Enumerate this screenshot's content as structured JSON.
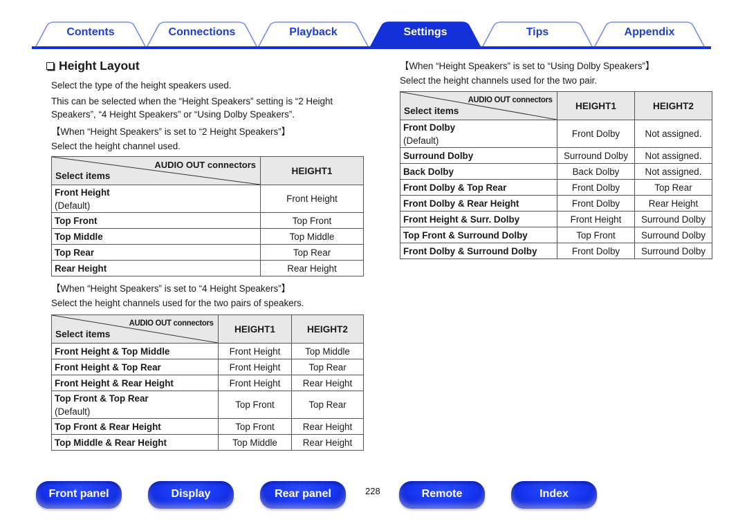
{
  "tabs": [
    {
      "label": "Contents",
      "active": false
    },
    {
      "label": "Connections",
      "active": false
    },
    {
      "label": "Playback",
      "active": false
    },
    {
      "label": "Settings",
      "active": true
    },
    {
      "label": "Tips",
      "active": false
    },
    {
      "label": "Appendix",
      "active": false
    }
  ],
  "section": {
    "icon": "checkbox-icon",
    "title": "Height Layout",
    "intro1": "Select the type of the height speakers used.",
    "intro2": "This can be selected when the “Height Speakers” setting is “2 Height Speakers”, “4 Height Speakers” or “Using Dolby Speakers”."
  },
  "block1": {
    "condition": "【When “Height Speakers” is set to “2 Height Speakers”】",
    "instruction": "Select the height channel used.",
    "header": {
      "diag_top": "AUDIO OUT connectors",
      "diag_bottom": "Select items",
      "cols": [
        "HEIGHT1"
      ]
    },
    "rows": [
      {
        "item": "Front Height",
        "sub": "(Default)",
        "values": [
          "Front Height"
        ]
      },
      {
        "item": "Top Front",
        "sub": "",
        "values": [
          "Top Front"
        ]
      },
      {
        "item": "Top Middle",
        "sub": "",
        "values": [
          "Top Middle"
        ]
      },
      {
        "item": "Top Rear",
        "sub": "",
        "values": [
          "Top Rear"
        ]
      },
      {
        "item": "Rear Height",
        "sub": "",
        "values": [
          "Rear Height"
        ]
      }
    ]
  },
  "block2": {
    "condition": "【When “Height Speakers” is set to “4 Height Speakers”】",
    "instruction": "Select the height channels used for the two pairs of speakers.",
    "header": {
      "diag_top": "AUDIO OUT connectors",
      "diag_bottom": "Select items",
      "cols": [
        "HEIGHT1",
        "HEIGHT2"
      ]
    },
    "rows": [
      {
        "item": "Front Height & Top Middle",
        "sub": "",
        "values": [
          "Front Height",
          "Top Middle"
        ]
      },
      {
        "item": "Front Height & Top Rear",
        "sub": "",
        "values": [
          "Front Height",
          "Top Rear"
        ]
      },
      {
        "item": "Front Height & Rear Height",
        "sub": "",
        "values": [
          "Front Height",
          "Rear Height"
        ]
      },
      {
        "item": "Top Front & Top Rear",
        "sub": "(Default)",
        "values": [
          "Top Front",
          "Top Rear"
        ]
      },
      {
        "item": "Top Front & Rear Height",
        "sub": "",
        "values": [
          "Top Front",
          "Rear Height"
        ]
      },
      {
        "item": "Top Middle & Rear Height",
        "sub": "",
        "values": [
          "Top Middle",
          "Rear Height"
        ]
      }
    ]
  },
  "block3": {
    "condition": "【When “Height Speakers” is set to “Using Dolby Speakers”】",
    "instruction": "Select the height channels used for the two pair.",
    "header": {
      "diag_top": "AUDIO OUT connectors",
      "diag_bottom": "Select items",
      "cols": [
        "HEIGHT1",
        "HEIGHT2"
      ]
    },
    "rows": [
      {
        "item": "Front Dolby",
        "sub": "(Default)",
        "values": [
          "Front Dolby",
          "Not assigned."
        ]
      },
      {
        "item": "Surround Dolby",
        "sub": "",
        "values": [
          "Surround Dolby",
          "Not assigned."
        ]
      },
      {
        "item": "Back Dolby",
        "sub": "",
        "values": [
          "Back Dolby",
          "Not assigned."
        ]
      },
      {
        "item": "Front Dolby & Top Rear",
        "sub": "",
        "values": [
          "Front Dolby",
          "Top Rear"
        ]
      },
      {
        "item": "Front Dolby & Rear Height",
        "sub": "",
        "values": [
          "Front Dolby",
          "Rear Height"
        ]
      },
      {
        "item": "Front Height & Surr. Dolby",
        "sub": "",
        "values": [
          "Front Height",
          "Surround Dolby"
        ]
      },
      {
        "item": "Top Front & Surround Dolby",
        "sub": "",
        "values": [
          "Top Front",
          "Surround Dolby"
        ]
      },
      {
        "item": "Front Dolby & Surround Dolby",
        "sub": "",
        "values": [
          "Front Dolby",
          "Surround Dolby"
        ]
      }
    ]
  },
  "bottom_nav": {
    "buttons": [
      "Front panel",
      "Display",
      "Rear panel",
      "Remote",
      "Index"
    ],
    "page_number": "228"
  },
  "colors": {
    "accent": "#1430d8",
    "tab_outline": "#7a8cf0",
    "header_bg": "#e8e8e8"
  }
}
